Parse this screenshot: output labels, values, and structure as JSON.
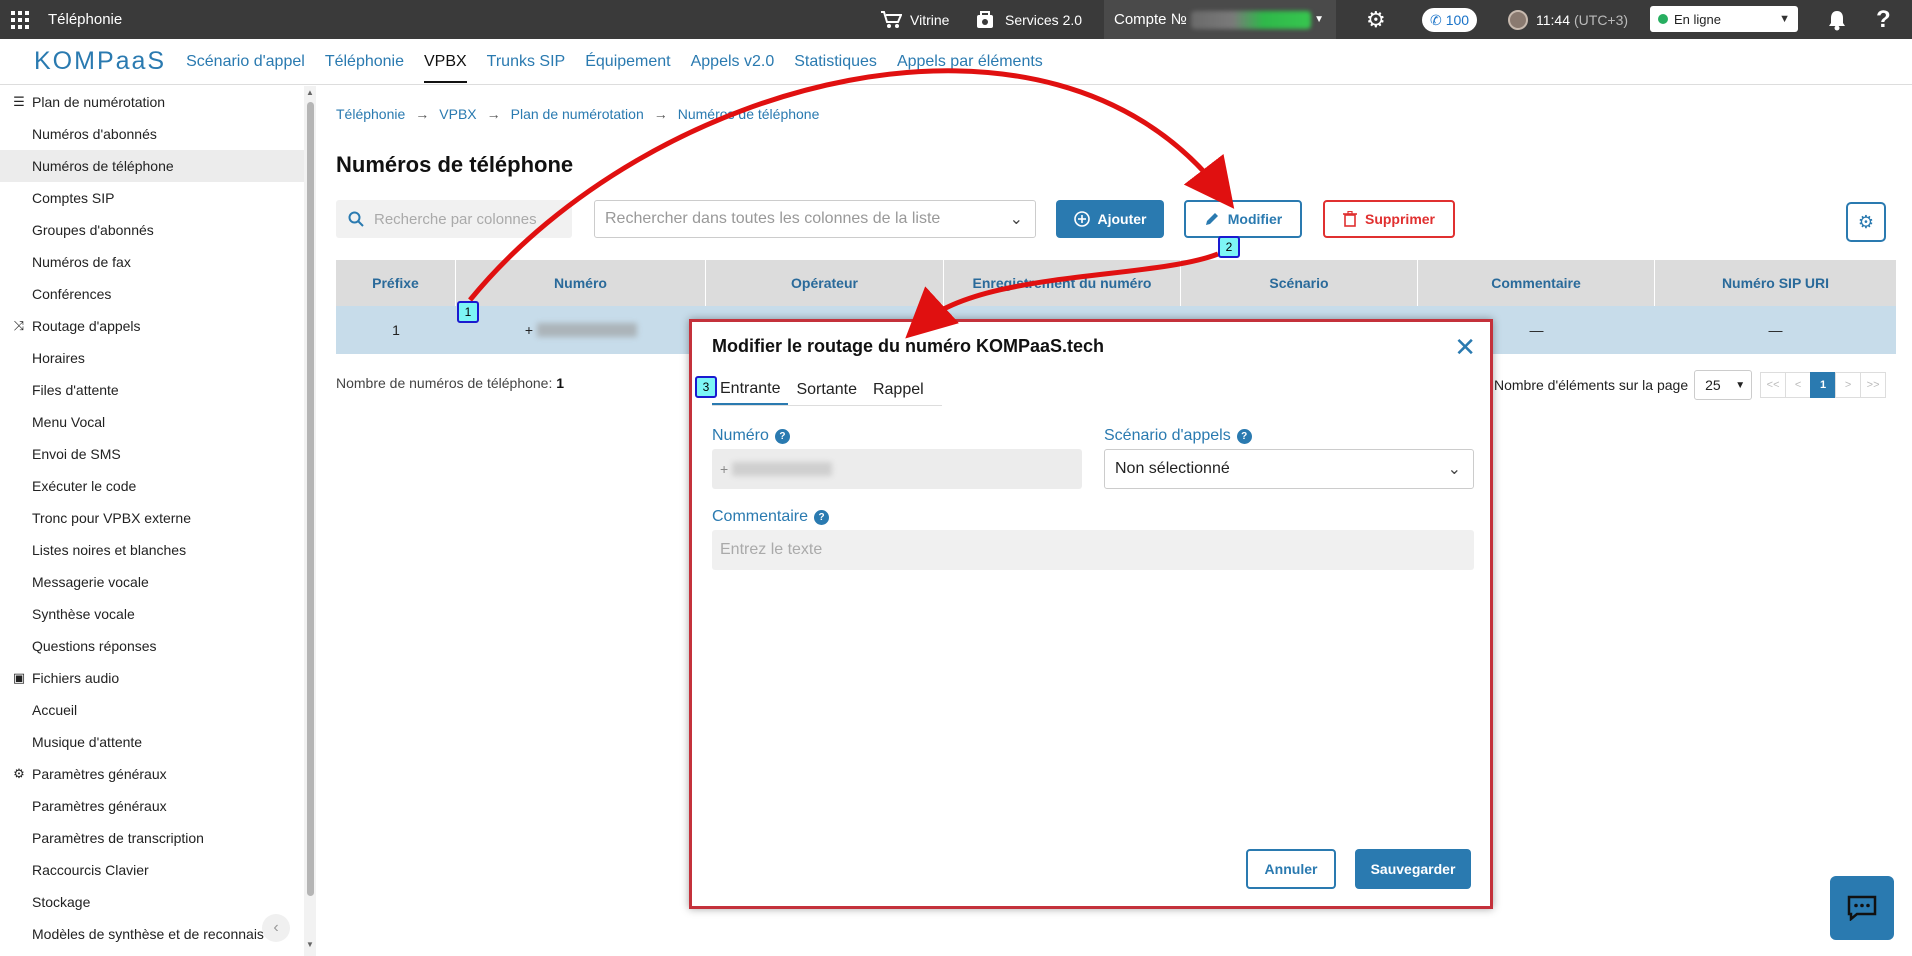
{
  "topbar": {
    "app_title": "Téléphonie",
    "vitrine": "Vitrine",
    "services": "Services 2.0",
    "compte_label": "Compte №",
    "calls_count": "100",
    "time": "11:44",
    "timezone": "(UTC+3)",
    "status": "En ligne"
  },
  "nav": {
    "logo": "KOMPaaS",
    "items": [
      "Scénario d'appel",
      "Téléphonie",
      "VPBX",
      "Trunks SIP",
      "Équipement",
      "Appels v2.0",
      "Statistiques",
      "Appels par éléments"
    ]
  },
  "sidebar": {
    "group1": "Plan de numérotation",
    "group1_items": [
      "Numéros d'abonnés",
      "Numéros de téléphone",
      "Comptes SIP",
      "Groupes d'abonnés",
      "Numéros de fax",
      "Conférences"
    ],
    "group2": "Routage d'appels",
    "group2_items": [
      "Horaires",
      "Files d'attente",
      "Menu Vocal",
      "Envoi de SMS",
      "Exécuter le code",
      "Tronc pour VPBX externe",
      "Listes noires et blanches",
      "Messagerie vocale",
      "Synthèse vocale",
      "Questions réponses"
    ],
    "group3": "Fichiers audio",
    "group3_items": [
      "Accueil",
      "Musique d'attente"
    ],
    "group4": "Paramètres généraux",
    "group4_items": [
      "Paramètres généraux",
      "Paramètres de transcription",
      "Raccourcis Clavier",
      "Stockage",
      "Modèles de synthèse et de reconnaissance"
    ]
  },
  "breadcrumb": [
    "Téléphonie",
    "VPBX",
    "Plan de numérotation",
    "Numéros de téléphone"
  ],
  "page_title": "Numéros de téléphone",
  "toolbar": {
    "search_placeholder": "Recherche par colonnes",
    "search_all_placeholder": "Rechercher dans toutes les colonnes de la liste",
    "add": "Ajouter",
    "edit": "Modifier",
    "delete": "Supprimer"
  },
  "table": {
    "columns": [
      "Préfixe",
      "Numéro",
      "Opérateur",
      "Enregistrement du numéro",
      "Scénario",
      "Commentaire",
      "Numéro SIP URI"
    ],
    "row": {
      "prefix": "1",
      "number_prefix": "+",
      "comment": "—",
      "sip_uri": "—"
    }
  },
  "footer": {
    "count_label": "Nombre de numéros de téléphone:",
    "count": "1",
    "per_page_label": "Nombre d'éléments sur la page",
    "per_page": "25",
    "pages": [
      "<<",
      "<",
      "1",
      ">",
      ">>"
    ]
  },
  "modal": {
    "title": "Modifier le routage du numéro KOMPaaS.tech",
    "tabs": [
      "Entrante",
      "Sortante",
      "Rappel"
    ],
    "numero_label": "Numéro",
    "numero_value": "+",
    "scenario_label": "Scénario d'appels",
    "scenario_value": "Non sélectionné",
    "comment_label": "Commentaire",
    "comment_placeholder": "Entrez le texte",
    "cancel": "Annuler",
    "save": "Sauvegarder"
  },
  "markers": [
    "1",
    "2",
    "3"
  ],
  "colors": {
    "accent": "#2a7ab0",
    "danger": "#e03030",
    "topbar": "#3a3a3a",
    "highlight_row": "#c7dcea",
    "annotation_red": "#c4313b"
  }
}
